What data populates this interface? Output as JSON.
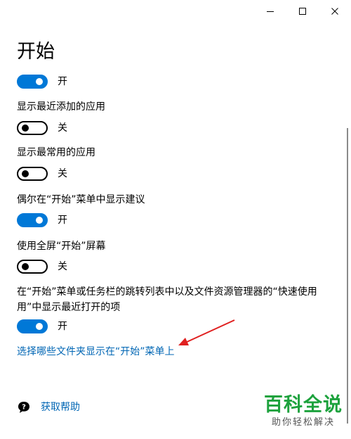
{
  "page": {
    "title": "开始"
  },
  "settings": [
    {
      "label": "",
      "state": "开",
      "on": true
    },
    {
      "label": "显示最近添加的应用",
      "state": "关",
      "on": false
    },
    {
      "label": "显示最常用的应用",
      "state": "关",
      "on": false
    },
    {
      "label": "偶尔在“开始”菜单中显示建议",
      "state": "开",
      "on": true
    },
    {
      "label": "使用全屏“开始”屏幕",
      "state": "关",
      "on": false
    },
    {
      "label": "在“开始”菜单或任务栏的跳转列表中以及文件资源管理器的“快速使用用”中显示最近打开的项",
      "state": "开",
      "on": true
    }
  ],
  "links": {
    "folders": "选择哪些文件夹显示在“开始”菜单上",
    "help": "获取帮助"
  },
  "watermark": {
    "title": "百科全说",
    "subtitle": "助你轻松解决"
  },
  "colors": {
    "accent": "#0078d7",
    "link": "#0066b4",
    "annotation": "#e02020",
    "watermark": "#1da23d"
  },
  "icons": {
    "minimize": "minimize-icon",
    "maximize": "maximize-icon",
    "close": "close-icon",
    "help": "help-chat-icon"
  }
}
